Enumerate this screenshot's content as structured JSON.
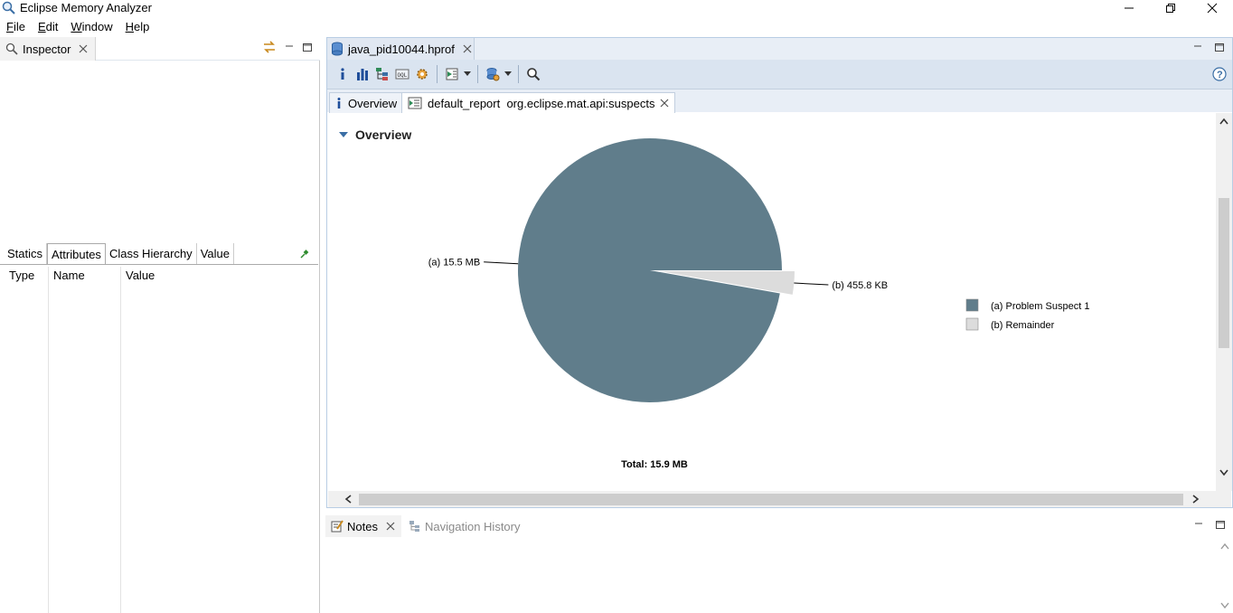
{
  "window": {
    "title": "Eclipse Memory Analyzer",
    "buttons": [
      "minimize-icon",
      "restore-icon",
      "close-icon"
    ]
  },
  "menu": {
    "items": [
      {
        "label": "File",
        "mnemonic": "F",
        "rest": "ile"
      },
      {
        "label": "Edit",
        "mnemonic": "E",
        "rest": "dit"
      },
      {
        "label": "Window",
        "mnemonic": "W",
        "rest": "indow"
      },
      {
        "label": "Help",
        "mnemonic": "H",
        "rest": "elp"
      }
    ]
  },
  "inspector": {
    "tab_label": "Inspector",
    "subtabs": [
      "Statics",
      "Attributes",
      "Class Hierarchy",
      "Value"
    ],
    "active_subtab": "Attributes",
    "columns": [
      "Type",
      "Name",
      "Value"
    ]
  },
  "editor": {
    "tab_label": "java_pid10044.hprof",
    "report_tabs": {
      "overview": "Overview",
      "report": "default_report  org.eclipse.mat.api:suspects"
    },
    "section_heading": "Overview"
  },
  "notes": {
    "tab_label": "Notes",
    "nav_tab_label": "Navigation History"
  },
  "colors": {
    "accent": "#b8cde4",
    "toolbar_bg": "#dae4f0",
    "slice_a": "#607d8b",
    "slice_b": "#dcdcdc"
  },
  "chart_data": {
    "type": "pie",
    "title": "",
    "slices": [
      {
        "label": "(a)",
        "name": "Problem Suspect 1",
        "value_mb": 15.5,
        "display": "15.5 MB"
      },
      {
        "label": "(b)",
        "name": "Remainder",
        "value_mb": 0.4451,
        "display": "455.8 KB"
      }
    ],
    "total_label": "Total: 15.9 MB",
    "legend_placement": "right"
  }
}
